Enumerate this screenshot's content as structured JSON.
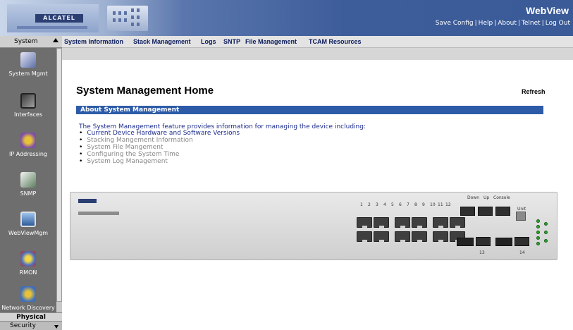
{
  "header": {
    "brand": "ALCATEL",
    "app_name": "WebView",
    "links": [
      "Save Config",
      "Help",
      "About",
      "Telnet",
      "Log Out"
    ]
  },
  "sidebar": {
    "heading": "System",
    "items": [
      {
        "label": "System Mgmt",
        "icon": "system-mgmt-icon"
      },
      {
        "label": "Interfaces",
        "icon": "interfaces-icon"
      },
      {
        "label": "IP Addressing",
        "icon": "ip-addressing-icon"
      },
      {
        "label": "SNMP",
        "icon": "snmp-icon"
      },
      {
        "label": "WebViewMgm",
        "icon": "webview-mgmt-icon"
      },
      {
        "label": "RMON",
        "icon": "rmon-icon"
      },
      {
        "label": "Network Discovery",
        "icon": "network-discovery-icon"
      }
    ],
    "footer_1": "Physical",
    "footer_2": "Security"
  },
  "menu": {
    "items": [
      "System Information",
      "Stack Management",
      "Logs",
      "SNTP",
      "File Management",
      "TCAM Resources"
    ]
  },
  "main": {
    "title": "System Management Home",
    "refresh": "Refresh",
    "section_title": "About System Management",
    "intro": "The System Management feature provides information for managing the device including:",
    "bullets": [
      "Current Device Hardware and Software Versions",
      "Stacking Mangement Information",
      "System File Mangement",
      "Configuring the System Time",
      "System Log Management"
    ]
  },
  "device": {
    "port_numbers": [
      "1",
      "2",
      "3",
      "4",
      "5",
      "6",
      "7",
      "8",
      "9",
      "10",
      "11",
      "12"
    ],
    "label_down": "Down",
    "label_up": "Up",
    "label_console": "Console",
    "label_unit": "Unit",
    "label_13": "13",
    "label_14": "14"
  },
  "colors": {
    "banner": "#3d5d9a",
    "section_bar": "#2d5ba8",
    "intro_text": "#1b2b8c",
    "sidebar": "#6e6e6e"
  }
}
